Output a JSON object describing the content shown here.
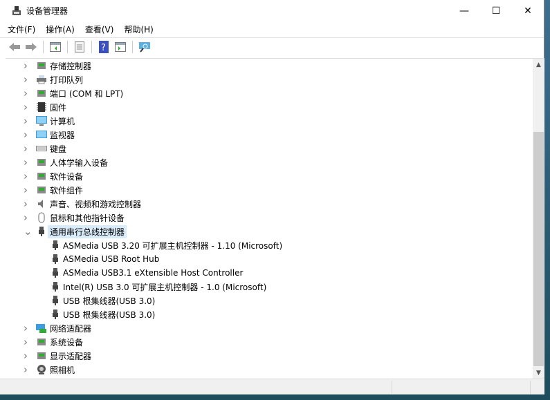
{
  "window": {
    "title": "设备管理器",
    "minimize": "—",
    "maximize": "☐",
    "close": "✕"
  },
  "menu": [
    "文件(F)",
    "操作(A)",
    "查看(V)",
    "帮助(H)"
  ],
  "toolbar": [
    "back-icon",
    "forward-icon",
    "show-hide-console-tree-icon",
    "properties-icon",
    "help-icon",
    "action-pane-icon",
    "scan-hardware-icon"
  ],
  "tree": [
    {
      "label": "存储控制器",
      "icon": "storage-controller-icon",
      "expanded": false
    },
    {
      "label": "打印队列",
      "icon": "printer-icon",
      "expanded": false
    },
    {
      "label": "端口 (COM 和 LPT)",
      "icon": "port-icon",
      "expanded": false
    },
    {
      "label": "固件",
      "icon": "firmware-icon",
      "expanded": false
    },
    {
      "label": "计算机",
      "icon": "computer-icon",
      "expanded": false
    },
    {
      "label": "监视器",
      "icon": "monitor-icon",
      "expanded": false
    },
    {
      "label": "键盘",
      "icon": "keyboard-icon",
      "expanded": false
    },
    {
      "label": "人体学输入设备",
      "icon": "hid-icon",
      "expanded": false
    },
    {
      "label": "软件设备",
      "icon": "software-device-icon",
      "expanded": false
    },
    {
      "label": "软件组件",
      "icon": "software-component-icon",
      "expanded": false
    },
    {
      "label": "声音、视频和游戏控制器",
      "icon": "speaker-icon",
      "expanded": false
    },
    {
      "label": "鼠标和其他指针设备",
      "icon": "mouse-icon",
      "expanded": false
    },
    {
      "label": "通用串行总线控制器",
      "icon": "usb-icon",
      "expanded": true,
      "selected": true,
      "children": [
        "ASMedia USB 3.20 可扩展主机控制器 - 1.10 (Microsoft)",
        "ASMedia USB Root Hub",
        "ASMedia USB3.1 eXtensible Host Controller",
        "Intel(R) USB 3.0 可扩展主机控制器 - 1.0 (Microsoft)",
        "USB 根集线器(USB 3.0)",
        "USB 根集线器(USB 3.0)"
      ]
    },
    {
      "label": "网络适配器",
      "icon": "network-adapter-icon",
      "expanded": false
    },
    {
      "label": "系统设备",
      "icon": "system-device-icon",
      "expanded": false
    },
    {
      "label": "显示适配器",
      "icon": "display-adapter-icon",
      "expanded": false
    },
    {
      "label": "照相机",
      "icon": "camera-icon",
      "expanded": false
    }
  ],
  "colors": {
    "selection": "#d9ebf9",
    "scroll_thumb": "#cdcdcd"
  }
}
